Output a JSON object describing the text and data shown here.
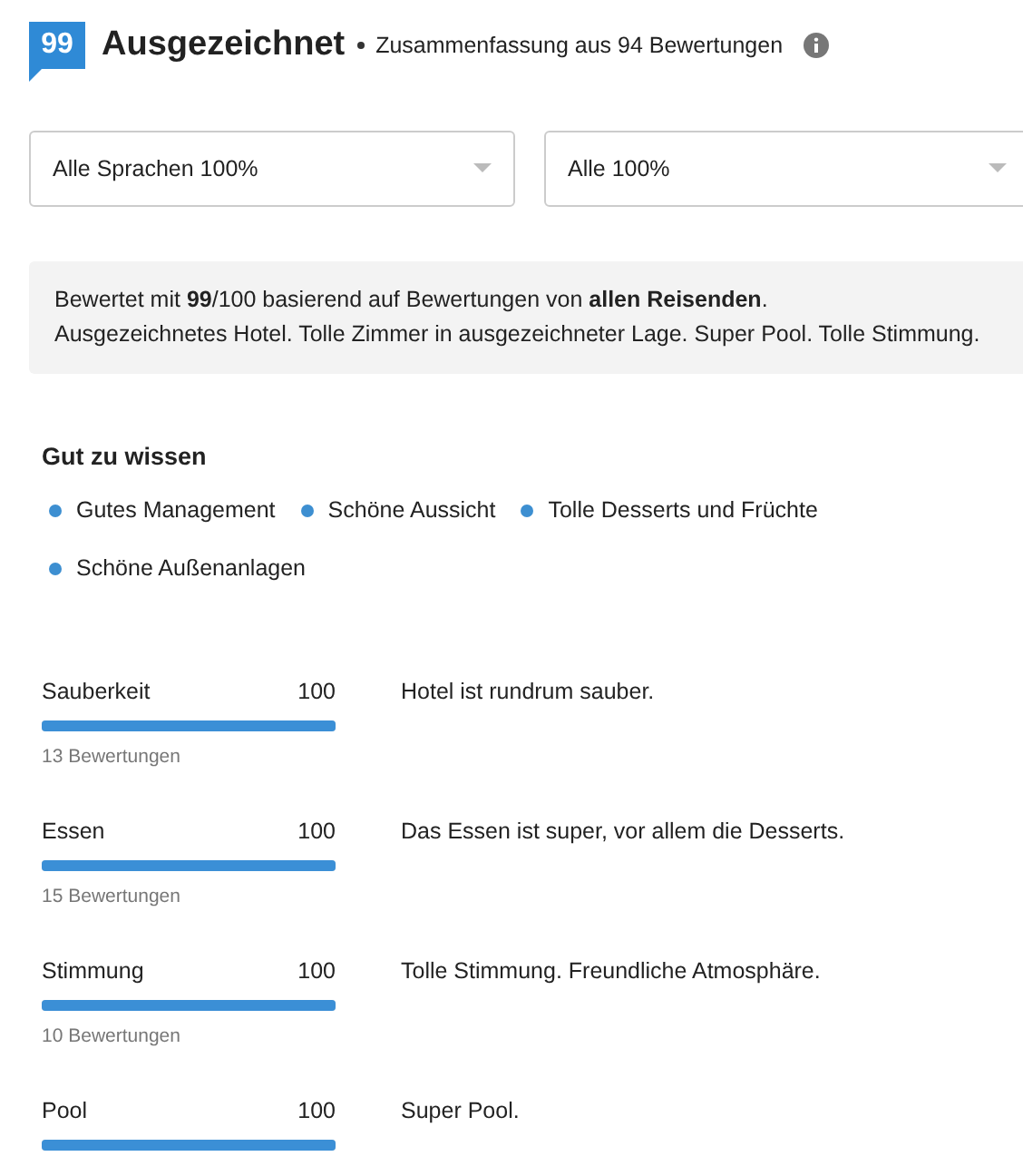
{
  "header": {
    "score": "99",
    "rating": "Ausgezeichnet",
    "summary": "Zusammenfassung aus 94 Bewertungen"
  },
  "filters": [
    {
      "value": "Alle Sprachen 100%"
    },
    {
      "value": "Alle 100%"
    }
  ],
  "summary_box": {
    "lines": [
      "Bewertet mit **99**/100 basierend auf Bewertungen von **allen Reisenden**.",
      "Ausgezeichnetes Hotel. Tolle Zimmer in ausgezeichneter Lage. Super Pool. Tolle Stimmung."
    ]
  },
  "good_to_know": {
    "title": "Gut zu wissen",
    "items": [
      "Gutes Management",
      "Schöne Aussicht",
      "Tolle Desserts und Früchte",
      "Schöne Außenanlagen"
    ]
  },
  "categories": [
    {
      "name": "Sauberkeit",
      "score": "100",
      "level": 1,
      "count": "13 Bewertungen",
      "comment": "Hotel ist rundrum sauber."
    },
    {
      "name": "Essen",
      "score": "100",
      "level": 1,
      "count": "15 Bewertungen",
      "comment": "Das Essen ist super, vor allem die Desserts."
    },
    {
      "name": "Stimmung",
      "score": "100",
      "level": 1,
      "count": "10 Bewertungen",
      "comment": "Tolle Stimmung. Freundliche Atmosphäre."
    },
    {
      "name": "Pool",
      "score": "100",
      "level": 1,
      "comment": "Super Pool."
    }
  ]
}
